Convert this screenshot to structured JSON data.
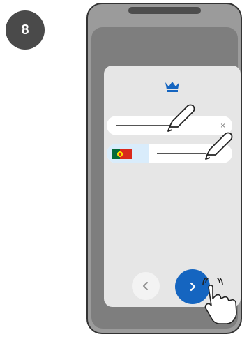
{
  "step": {
    "number": "8"
  },
  "dialog": {
    "icon": "crown-icon",
    "fields": [
      {
        "type": "name",
        "placeholder": "",
        "clear_icon": "×"
      },
      {
        "type": "phone",
        "country": "Portugal",
        "flag_icon": "portugal-flag-icon",
        "placeholder": ""
      }
    ],
    "nav": {
      "back_icon": "chevron-left-icon",
      "next_icon": "chevron-right-icon"
    }
  },
  "colors": {
    "accent": "#1565c0",
    "phone_body": "#9b9b9b",
    "screen": "#7e7e7e",
    "dialog_bg": "#e6e6e6",
    "country_bg": "#d9ecfb",
    "badge_bg": "#4a4a4a"
  }
}
